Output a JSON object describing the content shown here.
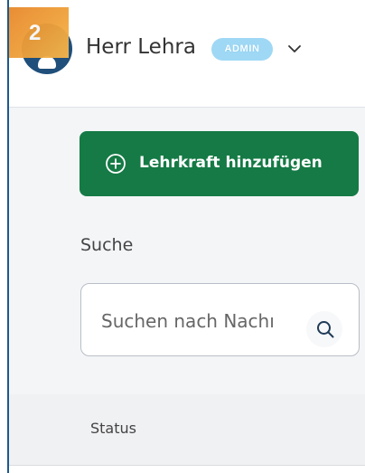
{
  "step_badge": {
    "number": "2"
  },
  "user": {
    "name": "Herr Lehra",
    "role": "ADMIN"
  },
  "actions": {
    "add_teacher_label": "Lehrkraft hinzufügen"
  },
  "search": {
    "label": "Suche",
    "placeholder": "Suchen nach Nachı"
  },
  "table": {
    "columns": [
      "Status"
    ]
  },
  "icons": {
    "add": "plus-circle-icon",
    "search": "search-icon",
    "menu": "chevron-down-icon",
    "avatar": "person-icon"
  },
  "colors": {
    "primary_button": "#157a45",
    "role_badge": "#9fd8f5",
    "avatar": "#1f4f7a",
    "step_badge": "#f0a23a"
  }
}
